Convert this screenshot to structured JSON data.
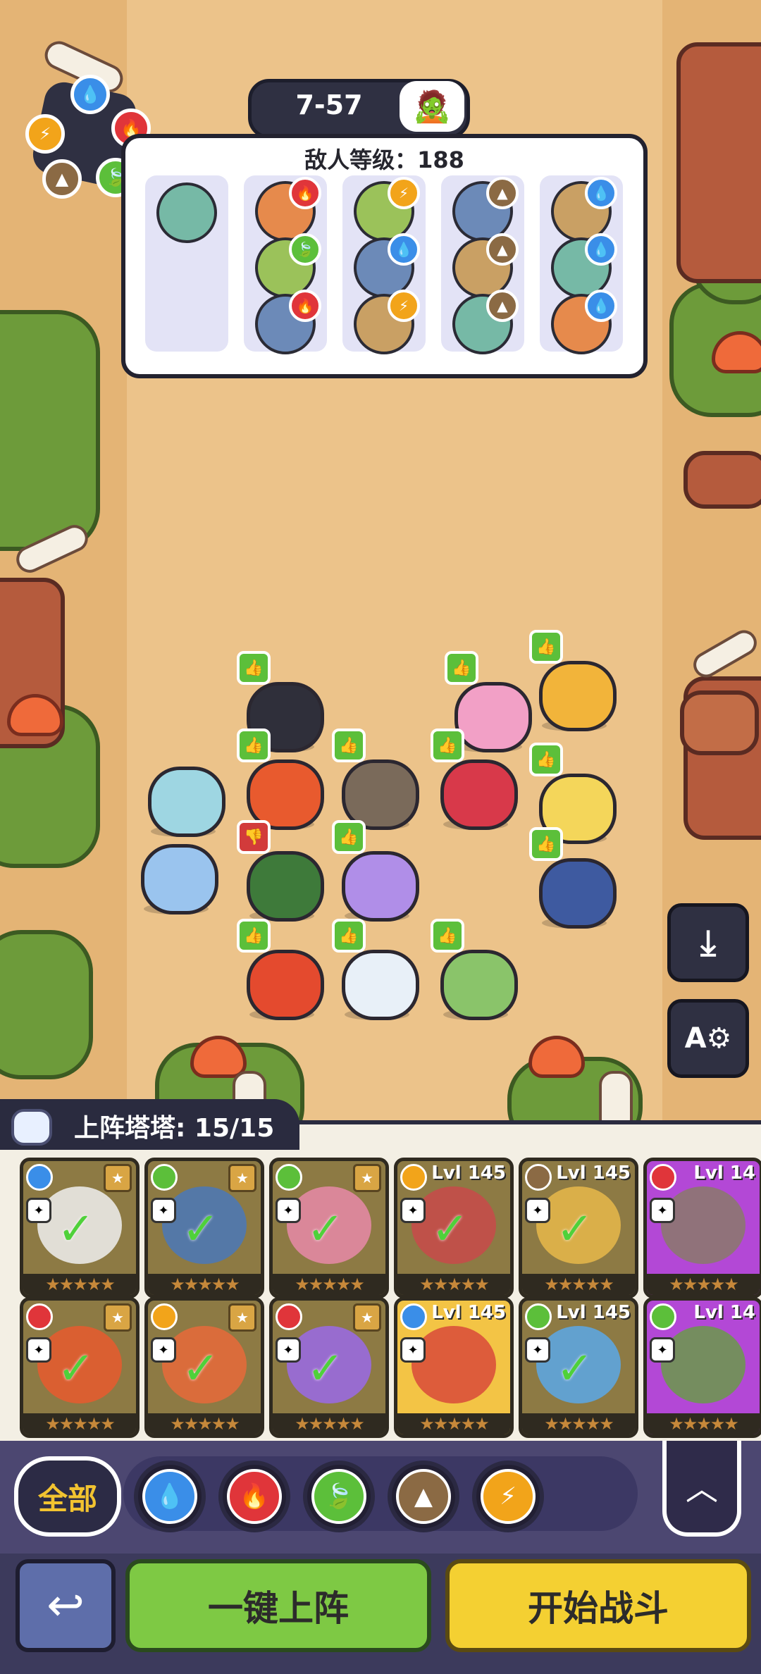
{
  "stage": {
    "label": "7-57",
    "boss_icon": "zombie-question-icon"
  },
  "enemy_panel": {
    "level_text": "敌人等级：188",
    "waves": [
      {
        "enemies": [
          {
            "element": null
          }
        ]
      },
      {
        "enemies": [
          {
            "element": "fire"
          },
          {
            "element": "grass"
          },
          {
            "element": "fire"
          }
        ]
      },
      {
        "enemies": [
          {
            "element": "lightning"
          },
          {
            "element": "water"
          },
          {
            "element": "lightning"
          }
        ]
      },
      {
        "enemies": [
          {
            "element": "earth"
          },
          {
            "element": "earth"
          },
          {
            "element": "earth"
          }
        ]
      },
      {
        "enemies": [
          {
            "element": "water"
          },
          {
            "element": "water"
          },
          {
            "element": "water"
          }
        ]
      }
    ]
  },
  "element_colors": {
    "water": "#3a8ee8",
    "fire": "#e0353a",
    "grass": "#5cbf3a",
    "earth": "#8b6a44",
    "lightning": "#f2a41a"
  },
  "element_icons": {
    "water": "💧",
    "fire": "🔥",
    "grass": "🍃",
    "earth": "▲",
    "lightning": "⚡"
  },
  "roster": {
    "label": "上阵塔塔: 15/15",
    "cards_row1": [
      {
        "element": "water",
        "level": "",
        "deployed": true,
        "frame": "dim"
      },
      {
        "element": "grass",
        "level": "",
        "deployed": true,
        "frame": "dim"
      },
      {
        "element": "grass",
        "level": "",
        "deployed": true,
        "frame": "dim"
      },
      {
        "element": "lightning",
        "level": "Lvl 145",
        "deployed": true,
        "frame": "dim"
      },
      {
        "element": "earth",
        "level": "Lvl 145",
        "deployed": true,
        "frame": "dim"
      },
      {
        "element": "fire",
        "level": "Lvl 14",
        "deployed": false,
        "frame": "purple"
      }
    ],
    "cards_row2": [
      {
        "element": "fire",
        "level": "",
        "deployed": true,
        "frame": "dim"
      },
      {
        "element": "lightning",
        "level": "",
        "deployed": true,
        "frame": "dim"
      },
      {
        "element": "fire",
        "level": "",
        "deployed": true,
        "frame": "dim"
      },
      {
        "element": "water",
        "level": "Lvl 145",
        "deployed": false,
        "frame": "gold"
      },
      {
        "element": "grass",
        "level": "Lvl 145",
        "deployed": true,
        "frame": "dim"
      },
      {
        "element": "grass",
        "level": "Lvl 14",
        "deployed": false,
        "frame": "purple"
      }
    ]
  },
  "filters": {
    "all_label": "全部",
    "buttons": [
      "water",
      "fire",
      "grass",
      "earth",
      "lightning"
    ]
  },
  "actions": {
    "auto_deploy_label": "一键上阵",
    "start_battle_label": "开始战斗"
  }
}
